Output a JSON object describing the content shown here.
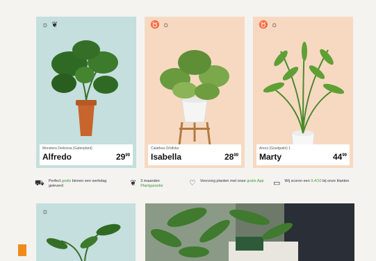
{
  "colors": {
    "card_teal": "#c4dfdd",
    "card_peach": "#f7d9c2",
    "accent_orange": "#f08a1a",
    "link_green": "#3a9a3a"
  },
  "products": [
    {
      "bg": "#c4dfdd",
      "icons": [
        "sun-icon",
        "pet-friendly-icon"
      ],
      "latin": "Monstera Deliciosa (Gatenplant)",
      "name": "Alfredo",
      "price_whole": "29",
      "price_cents": "99"
    },
    {
      "bg": "#f7d9c2",
      "icons": [
        "cat-safe-icon",
        "sun-icon"
      ],
      "latin": "Calathea Orbifolia",
      "name": "Isabella",
      "price_whole": "28",
      "price_cents": "99"
    },
    {
      "bg": "#f7d9c2",
      "icons": [
        "cat-safe-icon",
        "sun-icon"
      ],
      "latin": "Areca (Goudpalm) 1",
      "name": "Marty",
      "price_whole": "44",
      "price_cents": "99"
    }
  ],
  "usps": [
    {
      "icon": "truck-icon",
      "text_a": "Perfect ",
      "text_green": "gratis",
      "text_b": " binnen een werkdag geleverd"
    },
    {
      "icon": "plant-icon",
      "text_a": "3 maanden ",
      "text_green": "Plantgarantie",
      "text_b": ""
    },
    {
      "icon": "heart-icon",
      "text_a": "Voorzorg planten met onze ",
      "text_green": "gratis App",
      "text_b": ""
    },
    {
      "icon": "chat-icon",
      "text_a": "Wij scoren een ",
      "text_green": "9,4/10",
      "text_b": " bij onze klanten"
    }
  ],
  "second_row": {
    "card_icons": [
      "sun-icon"
    ]
  }
}
